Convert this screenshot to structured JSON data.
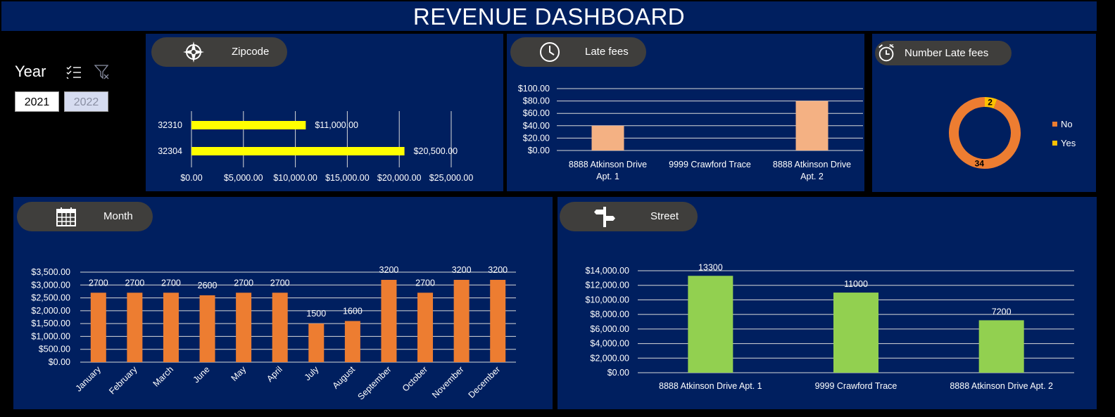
{
  "title": "REVENUE DASHBOARD",
  "slicer": {
    "label": "Year",
    "options": [
      "2021",
      "2022"
    ],
    "selected": "2021",
    "icons": [
      "multi-select-icon",
      "clear-filter-icon"
    ]
  },
  "cards": {
    "zipcode": {
      "label": "Zipcode",
      "icon": "compass-icon"
    },
    "late_fees": {
      "label": "Late fees",
      "icon": "clock-icon"
    },
    "number_late_fees": {
      "label": "Number Late fees",
      "icon": "alarm-clock-icon"
    },
    "month": {
      "label": "Month",
      "icon": "calendar-icon"
    },
    "street": {
      "label": "Street",
      "icon": "signpost-icon"
    }
  },
  "colors": {
    "panel": "#001f5f",
    "pill": "#3f3e3c",
    "yellow": "#ffff00",
    "orange": "#ed7d31",
    "peach": "#f4b183",
    "green": "#92d050",
    "donut_yes": "#ffc000"
  },
  "chart_data": [
    {
      "id": "zipcode",
      "type": "bar",
      "orientation": "horizontal",
      "categories": [
        "32310",
        "32304"
      ],
      "values": [
        11000,
        20500
      ],
      "data_labels": [
        "$11,000.00",
        "$20,500.00"
      ],
      "xlim": [
        0,
        25000
      ],
      "x_ticks": [
        "$0.00",
        "$5,000.00",
        "$10,000.00",
        "$15,000.00",
        "$20,000.00",
        "$25,000.00"
      ],
      "grid": true
    },
    {
      "id": "late_fees",
      "type": "bar",
      "categories": [
        "8888 Atkinson Drive Apt. 1",
        "9999 Crawford Trace",
        "8888 Atkinson Drive Apt. 2"
      ],
      "category_lines": [
        [
          "8888 Atkinson Drive",
          "Apt. 1"
        ],
        [
          "9999 Crawford Trace"
        ],
        [
          "8888 Atkinson Drive",
          "Apt. 2"
        ]
      ],
      "values": [
        40,
        0,
        80
      ],
      "ylim": [
        0,
        100
      ],
      "y_ticks": [
        "$0.00",
        "$20.00",
        "$40.00",
        "$60.00",
        "$80.00",
        "$100.00"
      ],
      "grid": true
    },
    {
      "id": "number_late_fees",
      "type": "pie",
      "style": "donut",
      "labels": [
        "No",
        "Yes"
      ],
      "values": [
        34,
        2
      ],
      "legend": "right"
    },
    {
      "id": "month",
      "type": "bar",
      "categories": [
        "January",
        "February",
        "March",
        "June",
        "May",
        "April",
        "July",
        "August",
        "September",
        "October",
        "November",
        "December"
      ],
      "values": [
        2700,
        2700,
        2700,
        2600,
        2700,
        2700,
        1500,
        1600,
        3200,
        2700,
        3200,
        3200
      ],
      "ylim": [
        0,
        3500
      ],
      "y_ticks": [
        "$0.00",
        "$500.00",
        "$1,000.00",
        "$1,500.00",
        "$2,000.00",
        "$2,500.00",
        "$3,000.00",
        "$3,500.00"
      ],
      "grid": true
    },
    {
      "id": "street",
      "type": "bar",
      "categories": [
        "8888 Atkinson Drive Apt. 1",
        "9999 Crawford Trace",
        "8888 Atkinson Drive Apt. 2"
      ],
      "values": [
        13300,
        11000,
        7200
      ],
      "ylim": [
        0,
        14000
      ],
      "y_ticks": [
        "$0.00",
        "$2,000.00",
        "$4,000.00",
        "$6,000.00",
        "$8,000.00",
        "$10,000.00",
        "$12,000.00",
        "$14,000.00"
      ],
      "grid": true
    }
  ]
}
